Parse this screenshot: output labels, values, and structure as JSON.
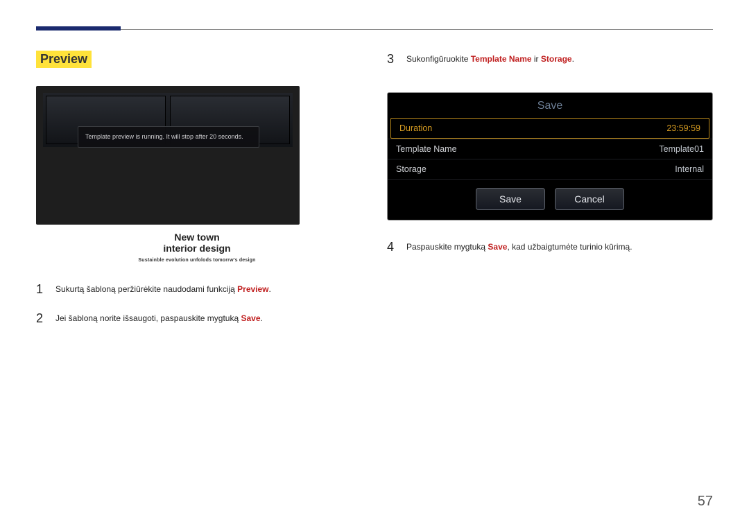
{
  "header": {
    "section_title": "Preview"
  },
  "left": {
    "toast": "Template preview is running. It will stop after 20 seconds.",
    "caption_line1": "New town",
    "caption_line2": "interior design",
    "caption_sub": "Sustainble evolution unfolods tomorrw's design",
    "steps": [
      {
        "num": "1",
        "pre": "Sukurtą šabloną peržiūrėkite naudodami funkciją ",
        "kw": "Preview",
        "post": "."
      },
      {
        "num": "2",
        "pre": "Jei šabloną norite išsaugoti, paspauskite mygtuką ",
        "kw": "Save",
        "post": "."
      }
    ]
  },
  "right": {
    "step3": {
      "num": "3",
      "pre": "Sukonfigūruokite ",
      "kw1": "Template Name",
      "mid": " ir ",
      "kw2": "Storage",
      "post": "."
    },
    "dialog": {
      "title": "Save",
      "rows": [
        {
          "label": "Duration",
          "value": "23:59:59",
          "hl": true
        },
        {
          "label": "Template Name",
          "value": "Template01"
        },
        {
          "label": "Storage",
          "value": "Internal"
        }
      ],
      "save": "Save",
      "cancel": "Cancel"
    },
    "step4": {
      "num": "4",
      "pre": "Paspauskite mygtuką ",
      "kw": "Save",
      "post": ", kad užbaigtumėte turinio kūrimą."
    }
  },
  "page_number": "57"
}
